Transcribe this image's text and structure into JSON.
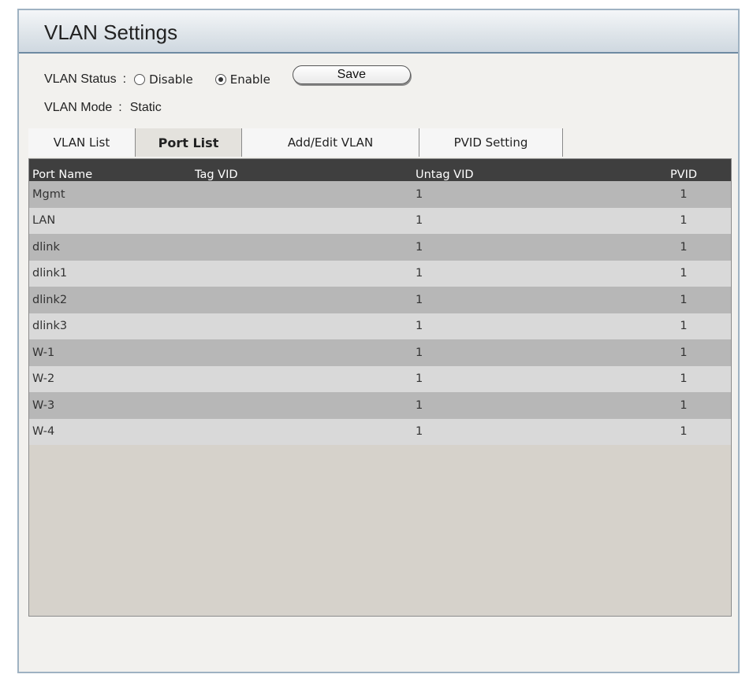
{
  "title": "VLAN Settings",
  "vlan_status": {
    "label": "VLAN Status",
    "colon": ":",
    "options": [
      {
        "label": "Disable",
        "checked": false
      },
      {
        "label": "Enable",
        "checked": true
      }
    ],
    "save_label": "Save"
  },
  "vlan_mode": {
    "label": "VLAN Mode",
    "colon": ":",
    "value": "Static"
  },
  "tabs": [
    {
      "label": "VLAN List",
      "active": false
    },
    {
      "label": "Port List",
      "active": true
    },
    {
      "label": "Add/Edit VLAN",
      "active": false
    },
    {
      "label": "PVID Setting",
      "active": false
    }
  ],
  "table": {
    "headers": [
      "Port Name",
      "Tag VID",
      "Untag VID",
      "PVID"
    ],
    "rows": [
      {
        "name": "Mgmt",
        "tag": "",
        "untag": "1",
        "pvid": "1"
      },
      {
        "name": "LAN",
        "tag": "",
        "untag": "1",
        "pvid": "1"
      },
      {
        "name": "dlink",
        "tag": "",
        "untag": "1",
        "pvid": "1"
      },
      {
        "name": "dlink1",
        "tag": "",
        "untag": "1",
        "pvid": "1"
      },
      {
        "name": "dlink2",
        "tag": "",
        "untag": "1",
        "pvid": "1"
      },
      {
        "name": "dlink3",
        "tag": "",
        "untag": "1",
        "pvid": "1"
      },
      {
        "name": "W-1",
        "tag": "",
        "untag": "1",
        "pvid": "1"
      },
      {
        "name": "W-2",
        "tag": "",
        "untag": "1",
        "pvid": "1"
      },
      {
        "name": "W-3",
        "tag": "",
        "untag": "1",
        "pvid": "1"
      },
      {
        "name": "W-4",
        "tag": "",
        "untag": "1",
        "pvid": "1"
      }
    ]
  }
}
